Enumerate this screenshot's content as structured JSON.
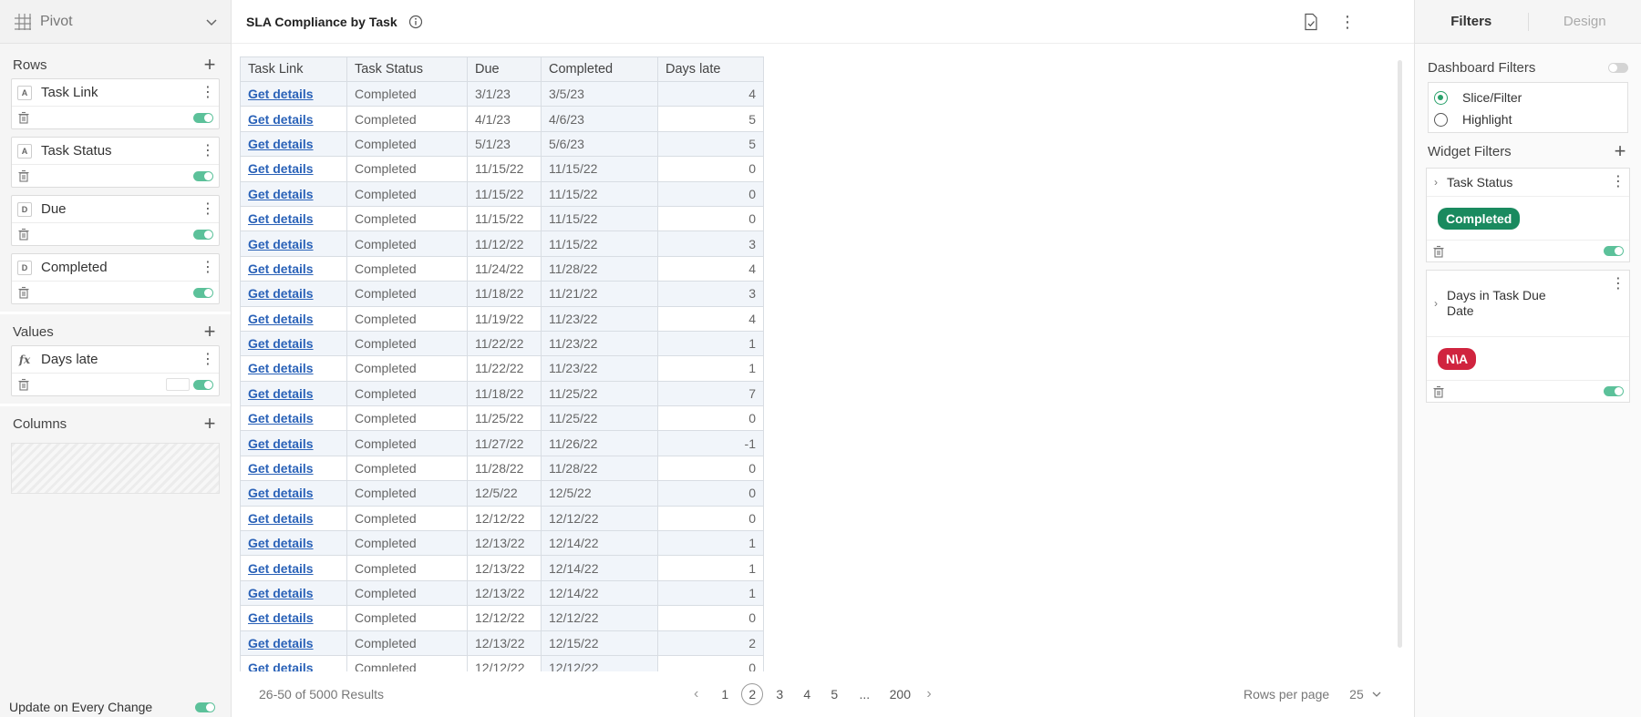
{
  "left_panel": {
    "title": "Pivot",
    "rows_label": "Rows",
    "rows": [
      {
        "type": "A",
        "name": "Task Link"
      },
      {
        "type": "A",
        "name": "Task Status"
      },
      {
        "type": "D",
        "name": "Due"
      },
      {
        "type": "D",
        "name": "Completed"
      }
    ],
    "values_label": "Values",
    "values": [
      {
        "type": "fx",
        "name": "Days late"
      }
    ],
    "columns_label": "Columns",
    "update_label": "Update on Every Change"
  },
  "widget": {
    "title": "SLA Compliance by Task"
  },
  "table": {
    "headers": [
      "Task Link",
      "Task Status",
      "Due",
      "Completed",
      "Days late"
    ],
    "rows": [
      [
        "Get details",
        "Completed",
        "3/1/23",
        "3/5/23",
        "4"
      ],
      [
        "Get details",
        "Completed",
        "4/1/23",
        "4/6/23",
        "5"
      ],
      [
        "Get details",
        "Completed",
        "5/1/23",
        "5/6/23",
        "5"
      ],
      [
        "Get details",
        "Completed",
        "11/15/22",
        "11/15/22",
        "0"
      ],
      [
        "Get details",
        "Completed",
        "11/15/22",
        "11/15/22",
        "0"
      ],
      [
        "Get details",
        "Completed",
        "11/15/22",
        "11/15/22",
        "0"
      ],
      [
        "Get details",
        "Completed",
        "11/12/22",
        "11/15/22",
        "3"
      ],
      [
        "Get details",
        "Completed",
        "11/24/22",
        "11/28/22",
        "4"
      ],
      [
        "Get details",
        "Completed",
        "11/18/22",
        "11/21/22",
        "3"
      ],
      [
        "Get details",
        "Completed",
        "11/19/22",
        "11/23/22",
        "4"
      ],
      [
        "Get details",
        "Completed",
        "11/22/22",
        "11/23/22",
        "1"
      ],
      [
        "Get details",
        "Completed",
        "11/22/22",
        "11/23/22",
        "1"
      ],
      [
        "Get details",
        "Completed",
        "11/18/22",
        "11/25/22",
        "7"
      ],
      [
        "Get details",
        "Completed",
        "11/25/22",
        "11/25/22",
        "0"
      ],
      [
        "Get details",
        "Completed",
        "11/27/22",
        "11/26/22",
        "-1"
      ],
      [
        "Get details",
        "Completed",
        "11/28/22",
        "11/28/22",
        "0"
      ],
      [
        "Get details",
        "Completed",
        "12/5/22",
        "12/5/22",
        "0"
      ],
      [
        "Get details",
        "Completed",
        "12/12/22",
        "12/12/22",
        "0"
      ],
      [
        "Get details",
        "Completed",
        "12/13/22",
        "12/14/22",
        "1"
      ],
      [
        "Get details",
        "Completed",
        "12/13/22",
        "12/14/22",
        "1"
      ],
      [
        "Get details",
        "Completed",
        "12/13/22",
        "12/14/22",
        "1"
      ],
      [
        "Get details",
        "Completed",
        "12/12/22",
        "12/12/22",
        "0"
      ],
      [
        "Get details",
        "Completed",
        "12/13/22",
        "12/15/22",
        "2"
      ],
      [
        "Get details",
        "Completed",
        "12/12/22",
        "12/12/22",
        "0"
      ]
    ]
  },
  "footer": {
    "results": "26-50 of 5000 Results",
    "pages": [
      "1",
      "2",
      "3",
      "4",
      "5",
      "...",
      "200"
    ],
    "active_page": "2",
    "rows_per_page_label": "Rows per page",
    "rows_per_page_value": "25"
  },
  "right_panel": {
    "tabs": [
      "Filters",
      "Design"
    ],
    "dashboard_filters_label": "Dashboard Filters",
    "radio_options": [
      "Slice/Filter",
      "Highlight"
    ],
    "widget_filters_label": "Widget Filters",
    "filters": [
      {
        "name": "Task Status",
        "chip": "Completed",
        "chip_color": "#1a8a5f"
      },
      {
        "name": "Days in Task Due Date",
        "chip": "N\\A",
        "chip_color": "#d0243f"
      }
    ]
  }
}
